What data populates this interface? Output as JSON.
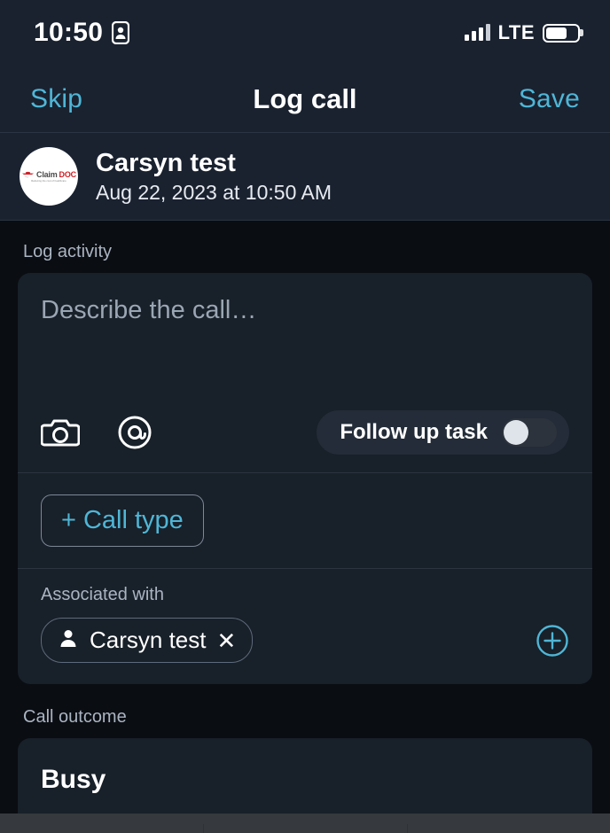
{
  "status_bar": {
    "time": "10:50",
    "badge_icon": "id-badge-icon",
    "network": "LTE",
    "signal_bars": 3,
    "battery_percent": 68
  },
  "nav": {
    "skip_label": "Skip",
    "title": "Log call",
    "save_label": "Save"
  },
  "contact": {
    "avatar_logo": {
      "mark": "caduceus-icon",
      "name_part1": "Claim",
      "name_part2": "DOC",
      "tagline": "Reducing the cost of healthcare"
    },
    "name": "Carsyn test",
    "datetime": "Aug 22, 2023 at 10:50 AM"
  },
  "log_activity": {
    "label": "Log activity",
    "note_placeholder": "Describe the call…",
    "note_value": "",
    "camera_icon": "camera-icon",
    "mention_icon": "at-mention-icon",
    "follow_up": {
      "label": "Follow up task",
      "enabled": false
    }
  },
  "call_type": {
    "plus": "+",
    "label": "Call type"
  },
  "associated_with": {
    "label": "Associated with",
    "chips": [
      {
        "icon": "person-icon",
        "name": "Carsyn test",
        "remove": "✕"
      }
    ],
    "add_icon": "plus-circle-icon"
  },
  "call_outcome": {
    "label": "Call outcome",
    "value": "Busy"
  },
  "colors": {
    "accent": "#4fb6d6",
    "header_bg": "#1a2230",
    "page_bg": "#0a0d12",
    "card_bg": "#182029",
    "logo_red": "#cf2027"
  }
}
